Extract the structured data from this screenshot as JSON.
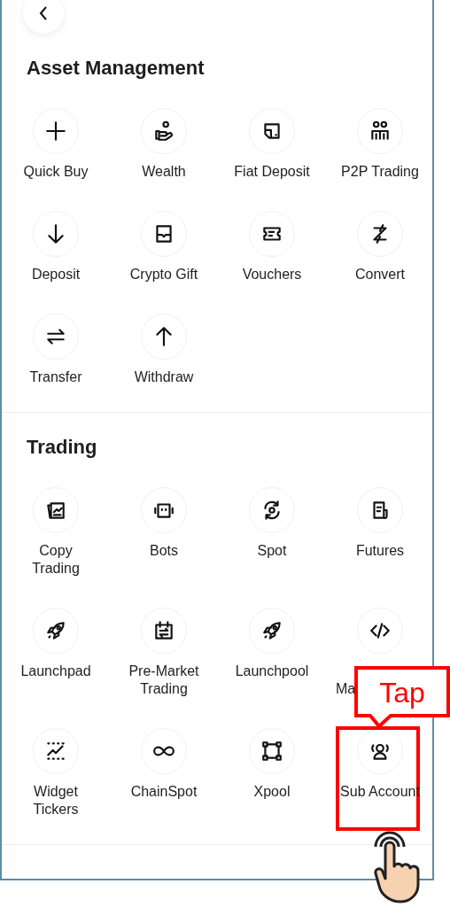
{
  "sections": [
    {
      "title": "Asset Management",
      "items": [
        {
          "label": "Quick Buy",
          "highlighted": false,
          "covered": false
        },
        {
          "label": "Wealth",
          "highlighted": false,
          "covered": false
        },
        {
          "label": "Fiat Deposit",
          "highlighted": false,
          "covered": false
        },
        {
          "label": "P2P Trading",
          "highlighted": false,
          "covered": false
        },
        {
          "label": "Deposit",
          "highlighted": false,
          "covered": false
        },
        {
          "label": "Crypto Gift",
          "highlighted": false,
          "covered": false
        },
        {
          "label": "Vouchers",
          "highlighted": false,
          "covered": false
        },
        {
          "label": "Convert",
          "highlighted": false,
          "covered": false
        },
        {
          "label": "Transfer",
          "highlighted": false,
          "covered": false
        },
        {
          "label": "Withdraw",
          "highlighted": false,
          "covered": false
        }
      ]
    },
    {
      "title": "Trading",
      "items": [
        {
          "label": "Copy Trading",
          "highlighted": false,
          "covered": false
        },
        {
          "label": "Bots",
          "highlighted": false,
          "covered": false
        },
        {
          "label": "Spot",
          "highlighted": false,
          "covered": false
        },
        {
          "label": "Futures",
          "highlighted": false,
          "covered": false
        },
        {
          "label": "Launchpad",
          "highlighted": false,
          "covered": false
        },
        {
          "label": "Pre-Market Trading",
          "highlighted": false,
          "covered": false
        },
        {
          "label": "Launchpool",
          "highlighted": false,
          "covered": false
        },
        {
          "label": "Ma",
          "highlighted": false,
          "covered": true
        },
        {
          "label": "Widget Tickers",
          "highlighted": false,
          "covered": false
        },
        {
          "label": "ChainSpot",
          "highlighted": false,
          "covered": false
        },
        {
          "label": "Xpool",
          "highlighted": false,
          "covered": false
        },
        {
          "label": "Sub Account",
          "highlighted": true,
          "covered": false
        }
      ]
    }
  ],
  "callout": {
    "text": "Tap"
  }
}
